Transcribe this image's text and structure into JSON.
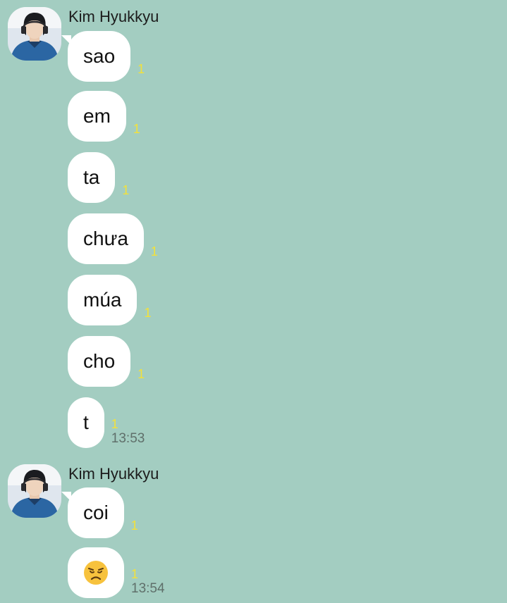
{
  "colors": {
    "background": "#a3cdc1",
    "bubble": "#ffffff",
    "unread_count": "#f3e13a",
    "timestamp": "#5f6f6a"
  },
  "groups": [
    {
      "sender": "Kim Hyukkyu",
      "avatar_icon": "profile-photo",
      "messages": [
        {
          "text": "sao",
          "unread": "1"
        },
        {
          "text": "em",
          "unread": "1"
        },
        {
          "text": "ta",
          "unread": "1"
        },
        {
          "text": "chưa",
          "unread": "1"
        },
        {
          "text": "múa",
          "unread": "1"
        },
        {
          "text": "cho",
          "unread": "1"
        },
        {
          "text": "t",
          "unread": "1",
          "time": "13:53"
        }
      ]
    },
    {
      "sender": "Kim Hyukkyu",
      "avatar_icon": "profile-photo",
      "messages": [
        {
          "text": "coi",
          "unread": "1"
        },
        {
          "emoji": "disappointed-face-emoji",
          "unread": "1",
          "time": "13:54"
        }
      ]
    }
  ]
}
